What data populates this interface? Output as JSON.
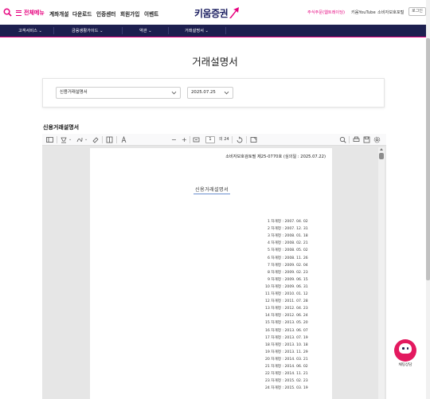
{
  "header": {
    "all_menu": "전체메뉴",
    "gnb": [
      "계좌개설",
      "다운로드",
      "인증센터",
      "회원가입",
      "이벤트"
    ],
    "logo_text": "키움증권",
    "util_links": [
      "주식주문(웹트레이딩)",
      "키움YouTube",
      "소비자보호포털"
    ],
    "login": "로그인",
    "brand_pink": "#e6007e",
    "brand_navy": "#1d1f4f"
  },
  "nav": {
    "items": [
      "고객서비스",
      "금융생활가이드",
      "약관",
      "거래설명서"
    ]
  },
  "page": {
    "title": "거래설명서",
    "select_doc": "신용거래설명서",
    "select_date": "2025.07.25",
    "section_title": "신용거래설명서"
  },
  "viewer": {
    "page_current": "1",
    "page_total": "의 24",
    "doc_ref": "소비자보호검토필 제25-0770호 (심의일 : 2025.07.22)",
    "doc_title": "신용거래설명서",
    "revisions": [
      {
        "label": "1 차개정",
        "date": "2007. 04. 02"
      },
      {
        "label": "2 차개정",
        "date": "2007. 12. 31"
      },
      {
        "label": "3 차개정",
        "date": "2008. 01. 18"
      },
      {
        "label": "4 차개정",
        "date": "2008. 02. 21"
      },
      {
        "label": "5 차개정",
        "date": "2008. 05. 02"
      },
      {
        "label": "6 차개정",
        "date": "2008. 11. 26"
      },
      {
        "label": "7 차개정",
        "date": "2009. 02. 04"
      },
      {
        "label": "8 차개정",
        "date": "2009. 02. 23"
      },
      {
        "label": "9 차개정",
        "date": "2009. 06. 15"
      },
      {
        "label": "10 차개정",
        "date": "2009. 06. 31"
      },
      {
        "label": "11 차개정",
        "date": "2010. 01. 12"
      },
      {
        "label": "12 차개정",
        "date": "2011. 07. 28"
      },
      {
        "label": "13 차개정",
        "date": "2012. 04. 23"
      },
      {
        "label": "14 차개정",
        "date": "2012. 06. 24"
      },
      {
        "label": "15 차개정",
        "date": "2013. 05. 20"
      },
      {
        "label": "16 차개정",
        "date": "2013. 06. 07"
      },
      {
        "label": "17 차개정",
        "date": "2013. 07. 19"
      },
      {
        "label": "18 차개정",
        "date": "2013. 10. 18"
      },
      {
        "label": "19 차개정",
        "date": "2013. 11. 29"
      },
      {
        "label": "20 차개정",
        "date": "2014. 03. 21"
      },
      {
        "label": "21 차개정",
        "date": "2014. 06. 02"
      },
      {
        "label": "22 차개정",
        "date": "2014. 11. 21"
      },
      {
        "label": "23 차개정",
        "date": "2015. 02. 23"
      },
      {
        "label": "24 차개정",
        "date": "2015. 03. 19"
      }
    ]
  },
  "chatbot": {
    "label": "채팅상담"
  }
}
